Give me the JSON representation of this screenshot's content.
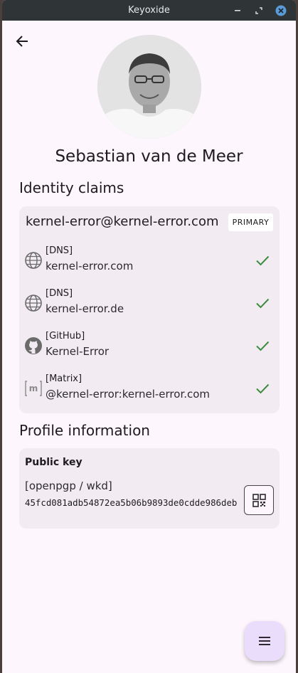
{
  "window": {
    "title": "Keyoxide"
  },
  "profile": {
    "name": "Sebastian van de Meer"
  },
  "sections": {
    "identity_claims": "Identity claims",
    "profile_information": "Profile information"
  },
  "identity": {
    "primary_email": "kernel-error@kernel-error.com",
    "primary_badge": "PRIMARY",
    "claims": [
      {
        "type": "[DNS]",
        "value": "kernel-error.com",
        "icon": "globe-icon",
        "verified": true
      },
      {
        "type": "[DNS]",
        "value": "kernel-error.de",
        "icon": "globe-icon",
        "verified": true
      },
      {
        "type": "[GitHub]",
        "value": "Kernel-Error",
        "icon": "github-icon",
        "verified": true
      },
      {
        "type": "[Matrix]",
        "value": "@kernel-error:kernel-error.com",
        "icon": "matrix-icon",
        "verified": true
      }
    ]
  },
  "public_key": {
    "label": "Public key",
    "source": "[openpgp / wkd]",
    "fingerprint": "45fcd081adb54872ea5b06b9893de0cdde986deb"
  },
  "colors": {
    "verified": "#3d8b40",
    "fab": "#eaddfc",
    "card": "#f2ecf2",
    "background": "#fdf7fd"
  }
}
